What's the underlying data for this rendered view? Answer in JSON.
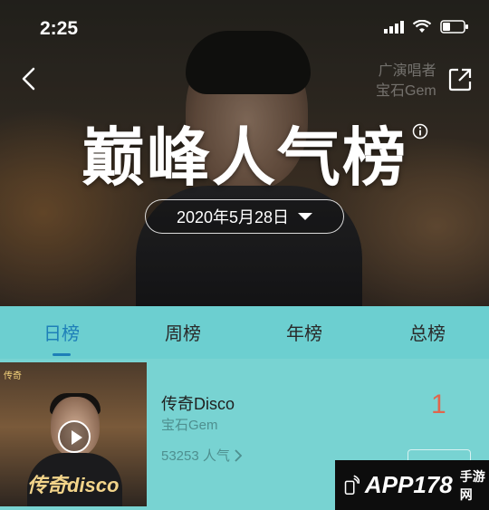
{
  "status_bar": {
    "time": "2:25"
  },
  "hero": {
    "title": "巅峰人气榜",
    "date": "2020年5月28日",
    "poster_lines": [
      "广演唱者",
      "宝石Gem"
    ]
  },
  "tabs": [
    {
      "label": "日榜",
      "active": true
    },
    {
      "label": "周榜",
      "active": false
    },
    {
      "label": "年榜",
      "active": false
    },
    {
      "label": "总榜",
      "active": false
    }
  ],
  "list": [
    {
      "title": "传奇Disco",
      "artist": "宝石Gem",
      "popularity": "53253 人气",
      "rank": "1",
      "cover_word": "传奇disco",
      "cover_tag": "传奇"
    }
  ],
  "watermark": {
    "brand": "APP178",
    "sub": "手游网"
  },
  "colors": {
    "tab_bg": "#6ccfd0",
    "active_tab": "#1e7fb8",
    "rank": "#e0664d"
  }
}
